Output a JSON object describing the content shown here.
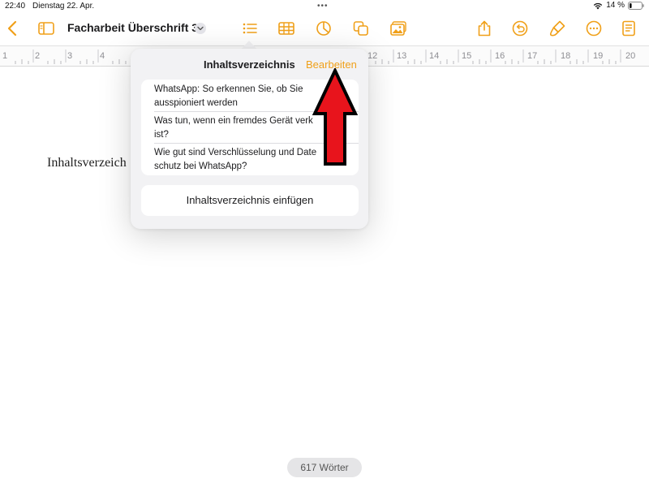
{
  "status_bar": {
    "time": "22:40",
    "date": "Dienstag 22. Apr.",
    "dots": "•••",
    "battery": "14 %"
  },
  "toolbar": {
    "document_title": "Facharbeit Überschrift 3",
    "icons": [
      "back-chevron-icon",
      "sidebar-icon",
      "chevron-down-icon",
      "list-icon",
      "table-icon",
      "chart-icon",
      "shapes-icon",
      "media-icon",
      "share-icon",
      "undo-icon",
      "format-brush-icon",
      "more-icon",
      "document-icon"
    ],
    "accent": "#f0a019"
  },
  "ruler": {
    "numbers": [
      "1",
      "2",
      "3",
      "4",
      "12",
      "13",
      "14",
      "15",
      "16",
      "17",
      "18",
      "19",
      "20"
    ]
  },
  "document": {
    "visible_text": "Inhaltsverzeich"
  },
  "toc_popover": {
    "title": "Inhaltsverzeichnis",
    "edit_label": "Bearbeiten",
    "items": [
      {
        "line1": "WhatsApp: So erkennen Sie, ob Sie",
        "line2": "ausspioniert werden"
      },
      {
        "line1": "Was tun, wenn ein fremdes Gerät verk",
        "line2": "ist?"
      },
      {
        "line1": "Wie gut sind Verschlüsselung und Date",
        "line2": "schutz bei WhatsApp?"
      }
    ],
    "insert_label": "Inhaltsverzeichnis einfügen"
  },
  "footer": {
    "word_count": "617 Wörter"
  },
  "annotation": {
    "arrow_color": "#e8141c"
  }
}
